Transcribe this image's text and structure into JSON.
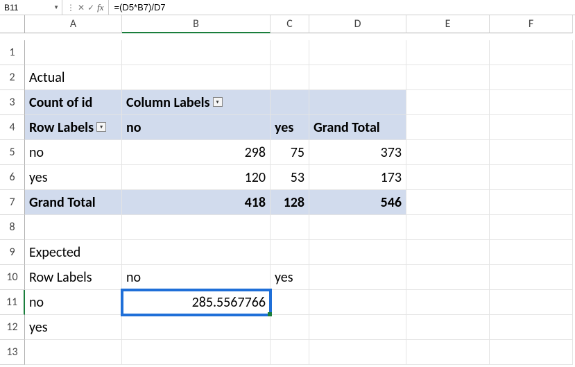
{
  "nameBox": "B11",
  "formula": "=(D5*B7)/D7",
  "columns": [
    "A",
    "B",
    "C",
    "D",
    "E",
    "F"
  ],
  "rows": [
    "1",
    "2",
    "3",
    "4",
    "5",
    "6",
    "7",
    "8",
    "9",
    "10",
    "11",
    "12",
    "13"
  ],
  "labels": {
    "actual": "Actual",
    "countOfId": "Count of id",
    "columnLabels": "Column Labels",
    "rowLabels": "Row Labels",
    "no": "no",
    "yes": "yes",
    "grandTotal": "Grand Total",
    "expected": "Expected"
  },
  "pivot": {
    "no_no": "298",
    "no_yes": "75",
    "no_total": "373",
    "yes_no": "120",
    "yes_yes": "53",
    "yes_total": "173",
    "gt_no": "418",
    "gt_yes": "128",
    "gt_total": "546"
  },
  "expectedValue": "285.5567766",
  "chart_data": {
    "type": "table",
    "title": "Actual — Count of id (pivot)",
    "row_labels": [
      "no",
      "yes",
      "Grand Total"
    ],
    "column_labels": [
      "no",
      "yes",
      "Grand Total"
    ],
    "values": [
      [
        298,
        75,
        373
      ],
      [
        120,
        53,
        173
      ],
      [
        418,
        128,
        546
      ]
    ],
    "expected_table": {
      "row_labels": [
        "no",
        "yes"
      ],
      "column_labels": [
        "no",
        "yes"
      ],
      "values": [
        [
          285.5567766,
          null
        ],
        [
          null,
          null
        ]
      ]
    }
  }
}
